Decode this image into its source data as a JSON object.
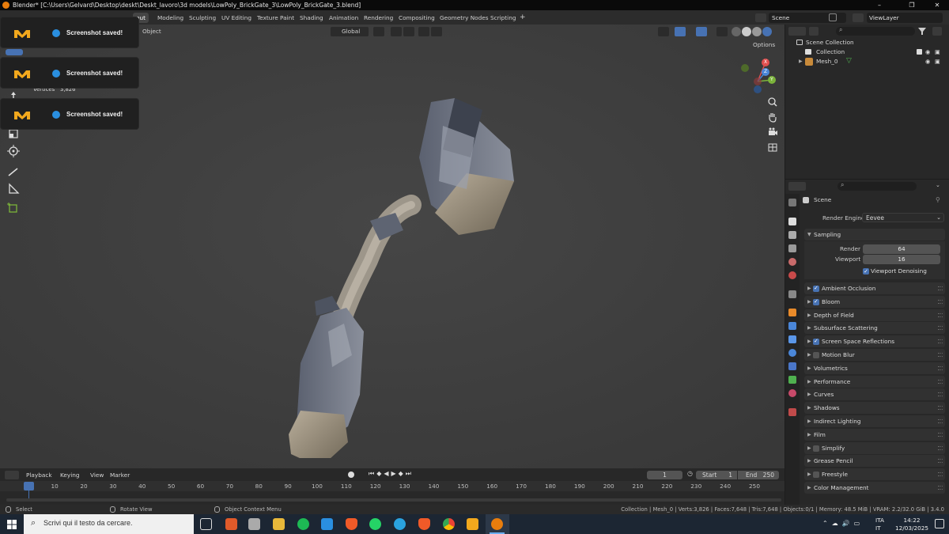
{
  "window": {
    "title": "Blender* [C:\\Users\\Gelvard\\Desktop\\deskt\\Deskt_lavoro\\3d models\\LowPoly_BrickGate_3\\LowPoly_BrickGate_3.blend]",
    "controls": [
      "–",
      "❐",
      "✕"
    ]
  },
  "menubar": {
    "workspaces": [
      "out",
      "Modeling",
      "Sculpting",
      "UV Editing",
      "Texture Paint",
      "Shading",
      "Animation",
      "Rendering",
      "Compositing",
      "Geometry Nodes",
      "Scripting"
    ],
    "add_tab": "+",
    "scene": "Scene",
    "view_layer": "ViewLayer"
  },
  "viewport": {
    "mode_label": "Object",
    "orientation": "Global",
    "options": "Options",
    "stats_label": "Vertices",
    "stats_value": "3,826",
    "gizmo": {
      "x": "X",
      "y": "Y",
      "z": "Z"
    }
  },
  "notifications": [
    {
      "text": "Screenshot saved!"
    },
    {
      "text": "Screenshot saved!"
    },
    {
      "text": "Screenshot saved!"
    }
  ],
  "outliner": {
    "rows": [
      {
        "label": "Scene Collection"
      },
      {
        "label": "Collection"
      },
      {
        "label": "Mesh_0"
      }
    ]
  },
  "properties": {
    "context": "Scene",
    "render_engine_label": "Render Engine",
    "render_engine": "Eevee",
    "sampling": {
      "title": "Sampling",
      "render_label": "Render",
      "render": "64",
      "viewport_label": "Viewport",
      "viewport": "16",
      "denoise_label": "Viewport Denoising"
    },
    "panels": [
      {
        "label": "Ambient Occlusion",
        "checkbox": true,
        "checked": true
      },
      {
        "label": "Bloom",
        "checkbox": true,
        "checked": true
      },
      {
        "label": "Depth of Field",
        "checkbox": false,
        "checked": false
      },
      {
        "label": "Subsurface Scattering",
        "checkbox": false,
        "checked": false
      },
      {
        "label": "Screen Space Reflections",
        "checkbox": true,
        "checked": true
      },
      {
        "label": "Motion Blur",
        "checkbox": true,
        "checked": false
      },
      {
        "label": "Volumetrics",
        "checkbox": false,
        "checked": false
      },
      {
        "label": "Performance",
        "checkbox": false,
        "checked": false
      },
      {
        "label": "Curves",
        "checkbox": false,
        "checked": false
      },
      {
        "label": "Shadows",
        "checkbox": false,
        "checked": false
      },
      {
        "label": "Indirect Lighting",
        "checkbox": false,
        "checked": false
      },
      {
        "label": "Film",
        "checkbox": false,
        "checked": false
      },
      {
        "label": "Simplify",
        "checkbox": true,
        "checked": false
      },
      {
        "label": "Grease Pencil",
        "checkbox": false,
        "checked": false
      },
      {
        "label": "Freestyle",
        "checkbox": true,
        "checked": false
      },
      {
        "label": "Color Management",
        "checkbox": false,
        "checked": false
      }
    ]
  },
  "timeline": {
    "menus": [
      "Playback",
      "Keying",
      "View",
      "Marker"
    ],
    "current_frame": "1",
    "start_label": "Start",
    "start": "1",
    "end_label": "End",
    "end": "250",
    "ticks": [
      "1",
      "10",
      "20",
      "30",
      "40",
      "50",
      "60",
      "70",
      "80",
      "90",
      "100",
      "110",
      "120",
      "130",
      "140",
      "150",
      "160",
      "170",
      "180",
      "190",
      "200",
      "210",
      "220",
      "230",
      "240",
      "250"
    ]
  },
  "statusbar": {
    "select": "Select",
    "rotate": "Rotate View",
    "context_menu": "Object Context Menu",
    "stats": "Collection | Mesh_0 | Verts:3,826 | Faces:7,648 | Tris:7,648 | Objects:0/1 | Memory: 48.5 MiB | VRAM: 2.2/32.0 GiB | 3.4.0"
  },
  "taskbar": {
    "search_placeholder": "Scrivi qui il testo da cercare.",
    "lang_top": "ITA",
    "lang_bottom": "IT",
    "time": "14:22",
    "date": "12/03/2025"
  },
  "colors": {
    "accent_blue": "#4772b3",
    "blender_orange": "#e87d0d",
    "gizmo_x": "#e04f4f",
    "gizmo_y": "#7bb33a",
    "gizmo_z": "#4a86d8"
  }
}
